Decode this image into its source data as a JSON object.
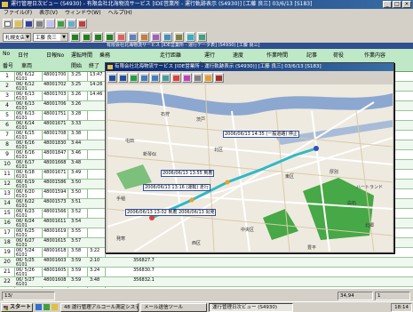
{
  "main_window": {
    "title": "運行管理日次ビュー (S4930) - 有限会社北海物流サービス [IDE営業所 - 運行軌跡表示 (S4930)] [工藤 良三] 03/6/13 [S183]",
    "controls": [
      "_",
      "□",
      "×"
    ]
  },
  "menubar": [
    "ファイル(F)",
    "表示(V)",
    "ウィンドウ(W)",
    "ヘルプ(H)"
  ],
  "filter": {
    "office": "札幌支店",
    "driver": "工藤 良三",
    "subtitle": "有限会社北海物流サービス [IDE営業所 - 運行データ表] (S4930) [工藤 良三]"
  },
  "grid": {
    "headers_top": [
      "No",
      "日付",
      "日報No",
      "運転時間",
      "乗務",
      "走行距離",
      "運行",
      "速度",
      "作業時間",
      "記事",
      "荷役",
      "作業内容"
    ],
    "headers_bottom": [
      "番号",
      "車両",
      "開始",
      "終了",
      "日 分",
      "km",
      "最高",
      "休憩",
      "待機",
      "荷役"
    ],
    "rows": [
      {
        "no": "1",
        "date": "06/ 6/12",
        "id": "48001700",
        "code": "6101",
        "time": "3:25",
        "km": "",
        "x": "13:47"
      },
      {
        "no": "2",
        "date": "06/ 6/12",
        "id": "48001702",
        "code": "6101",
        "time": "3:25",
        "km": "",
        "x": "14:26"
      },
      {
        "no": "3",
        "date": "06/ 6/13",
        "id": "48001703",
        "code": "6101",
        "time": "3:26",
        "km": "",
        "x": "14:46"
      },
      {
        "no": "4",
        "date": "06/ 6/13",
        "id": "48001706",
        "code": "6101",
        "time": "3:26",
        "km": "",
        "x": ""
      },
      {
        "no": "5",
        "date": "06/ 6/13",
        "id": "48001751",
        "code": "6101",
        "time": "3:28",
        "km": "",
        "x": ""
      },
      {
        "no": "6",
        "date": "06/ 6/14",
        "id": "48001671",
        "code": "6101",
        "time": "3:33",
        "km": "",
        "x": ""
      },
      {
        "no": "7",
        "date": "06/ 6/15",
        "id": "48001708",
        "code": "6101",
        "time": "3:38",
        "km": "",
        "x": ""
      },
      {
        "no": "8",
        "date": "06/ 6/16",
        "id": "48001830",
        "code": "6101",
        "time": "3:44",
        "km": "",
        "x": ""
      },
      {
        "no": "9",
        "date": "06/ 6/16",
        "id": "48001847",
        "code": "6101",
        "time": "3:46",
        "km": "",
        "x": ""
      },
      {
        "no": "10",
        "date": "06/ 6/17",
        "id": "48001668",
        "code": "6101",
        "time": "3:48",
        "km": "",
        "x": ""
      },
      {
        "no": "11",
        "date": "06/ 6/18",
        "id": "48001671",
        "code": "6101",
        "time": "3:49",
        "km": "",
        "x": ""
      },
      {
        "no": "12",
        "date": "06/ 6/19",
        "id": "48001586",
        "code": "6101",
        "time": "3:50",
        "km": "",
        "x": ""
      },
      {
        "no": "13",
        "date": "06/ 6/20",
        "id": "48001594",
        "code": "6101",
        "time": "3:50",
        "km": "",
        "x": ""
      },
      {
        "no": "14",
        "date": "06/ 6/22",
        "id": "48001573",
        "code": "6101",
        "time": "3:51",
        "km": "",
        "x": ""
      },
      {
        "no": "15",
        "date": "06/ 6/23",
        "id": "48001566",
        "code": "6101",
        "time": "3:52",
        "km": "",
        "x": ""
      },
      {
        "no": "16",
        "date": "06/ 6/24",
        "id": "48001611",
        "code": "6101",
        "time": "3:54",
        "km": "",
        "x": ""
      },
      {
        "no": "17",
        "date": "06/ 6/25",
        "id": "48001619",
        "code": "6101",
        "time": "3:55",
        "km": "",
        "x": ""
      },
      {
        "no": "18",
        "date": "06/ 6/27",
        "id": "48001615",
        "code": "6101",
        "time": "3:57",
        "km": "",
        "x": ""
      },
      {
        "no": "19",
        "date": "06/ 5/24",
        "id": "48001618",
        "code": "6101",
        "time": "3:58",
        "km": "356387.4",
        "x": "3:22"
      },
      {
        "no": "20",
        "date": "06/ 5/25",
        "id": "48001603",
        "code": "6101",
        "time": "3:59",
        "km": "356827.7",
        "x": "2:10"
      },
      {
        "no": "21",
        "date": "06/ 5/26",
        "id": "48001605",
        "code": "6101",
        "time": "3:59",
        "km": "356830.7",
        "x": "3:24"
      },
      {
        "no": "22",
        "date": "06/ 5/27",
        "id": "48001608",
        "code": "6101",
        "time": "3:59",
        "km": "356832.1",
        "x": "3:48"
      }
    ]
  },
  "map_window": {
    "title": "有限会社北海物流サービス [IDE営業所 - 運行軌跡表示 (S4930)] [工藤 良三] 03/6/13 [S183]",
    "callouts": [
      "2006/06/13 14:35 (一般道路) 停止",
      "2006/06/13 13:55 到着",
      "2006/06/13 13:16 (運転) 走行",
      "2006/06/13 13:02 到着 2006/06/13 出発"
    ],
    "labels": [
      "石狩",
      "厚別",
      "茨戸",
      "屯田",
      "新琴似",
      "北区",
      "東区",
      "中央区",
      "白石",
      "発寒",
      "西区",
      "手稲",
      "ハートランド",
      "北郷",
      "豊平"
    ],
    "colors": {
      "route": "#2fb8c8",
      "river": "#7090c0",
      "park": "#40a040",
      "road": "#ffffff",
      "land": "#efeae0"
    }
  },
  "status": {
    "record": "13/",
    "count": "34,94",
    "page": "1"
  },
  "taskbar": {
    "start": "スタート",
    "tasks": [
      "48 運行管理アルコール測定システム",
      "メール送信ツール",
      "運行管理日次ビュー (S4930)"
    ],
    "time": "18:14"
  }
}
